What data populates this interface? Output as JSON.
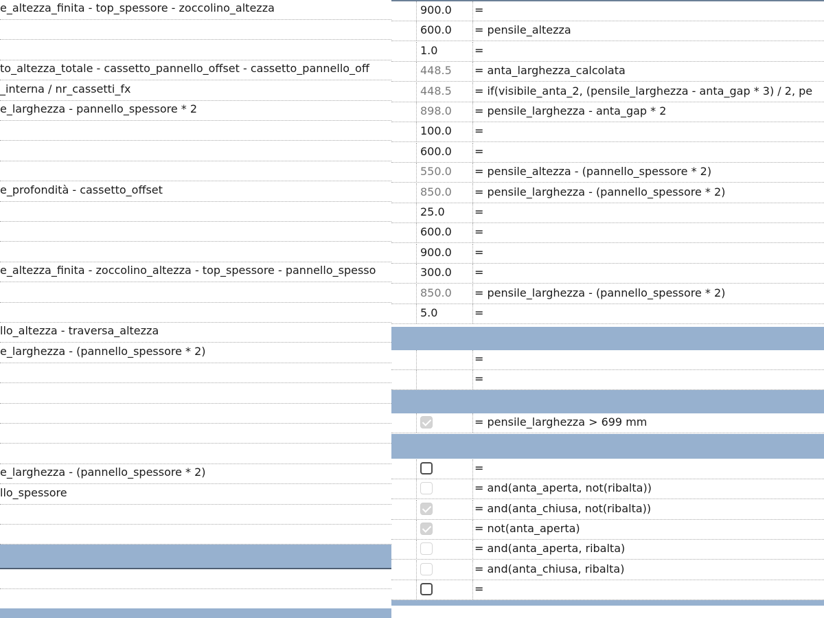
{
  "left_rows": [
    {
      "text": "e_altezza_finita - top_spessore - zoccolino_altezza"
    },
    {
      "text": ""
    },
    {
      "text": ""
    },
    {
      "text": "to_altezza_totale - cassetto_pannello_offset - cassetto_pannello_off"
    },
    {
      "text": "_interna / nr_cassetti_fx"
    },
    {
      "text": "e_larghezza - pannello_spessore * 2"
    },
    {
      "text": ""
    },
    {
      "text": ""
    },
    {
      "text": ""
    },
    {
      "text": "e_profondità - cassetto_offset"
    },
    {
      "text": ""
    },
    {
      "text": ""
    },
    {
      "text": ""
    },
    {
      "text": "e_altezza_finita - zoccolino_altezza - top_spessore - pannello_spesso"
    },
    {
      "text": ""
    },
    {
      "text": ""
    },
    {
      "text": "llo_altezza - traversa_altezza"
    },
    {
      "text": "e_larghezza - (pannello_spessore * 2)"
    },
    {
      "text": ""
    },
    {
      "text": ""
    },
    {
      "text": ""
    },
    {
      "text": ""
    },
    {
      "text": ""
    },
    {
      "text": "e_larghezza - (pannello_spessore * 2)"
    },
    {
      "text": "llo_spessore"
    },
    {
      "text": ""
    },
    {
      "text": ""
    },
    {
      "text": ""
    },
    {
      "text": ""
    },
    {
      "text": ""
    },
    {
      "text": ""
    }
  ],
  "right_rows": [
    {
      "value": "900.0",
      "formula": "="
    },
    {
      "value": "600.0",
      "formula": "= pensile_altezza"
    },
    {
      "value": "1.0",
      "formula": "="
    },
    {
      "value": "448.5",
      "formula": "= anta_larghezza_calcolata",
      "computed": true
    },
    {
      "value": "448.5",
      "formula": "= if(visibile_anta_2, (pensile_larghezza - anta_gap * 3) / 2, pe",
      "computed": true
    },
    {
      "value": "898.0",
      "formula": "= pensile_larghezza - anta_gap * 2",
      "computed": true
    },
    {
      "value": "100.0",
      "formula": "="
    },
    {
      "value": "600.0",
      "formula": "="
    },
    {
      "value": "550.0",
      "formula": "= pensile_altezza - (pannello_spessore * 2)",
      "computed": true
    },
    {
      "value": "850.0",
      "formula": "= pensile_larghezza - (pannello_spessore * 2)",
      "computed": true
    },
    {
      "value": "25.0",
      "formula": "="
    },
    {
      "value": "600.0",
      "formula": "="
    },
    {
      "value": "900.0",
      "formula": "="
    },
    {
      "value": "300.0",
      "formula": "="
    },
    {
      "value": "850.0",
      "formula": "= pensile_larghezza - (pannello_spessore * 2)",
      "computed": true
    },
    {
      "value": "5.0",
      "formula": "="
    }
  ],
  "right_rows_b": [
    {
      "value": "",
      "formula": "="
    },
    {
      "value": "",
      "formula": "="
    }
  ],
  "right_rows_c": [
    {
      "checkbox": "checked",
      "formula": "= pensile_larghezza > 699 mm"
    }
  ],
  "right_rows_d": [
    {
      "checkbox": "unchecked-dark",
      "formula": "="
    },
    {
      "checkbox": "unchecked",
      "formula": "= and(anta_aperta, not(ribalta))"
    },
    {
      "checkbox": "checked",
      "formula": "= and(anta_chiusa, not(ribalta))"
    },
    {
      "checkbox": "checked",
      "formula": "= not(anta_aperta)"
    },
    {
      "checkbox": "unchecked",
      "formula": "= and(anta_aperta, ribalta)"
    },
    {
      "checkbox": "unchecked",
      "formula": "= and(anta_chiusa, ribalta)"
    },
    {
      "checkbox": "unchecked-dark",
      "formula": "="
    }
  ],
  "colors": {
    "group_band": "#97b1cf",
    "computed_value": "#7a7a7a"
  }
}
